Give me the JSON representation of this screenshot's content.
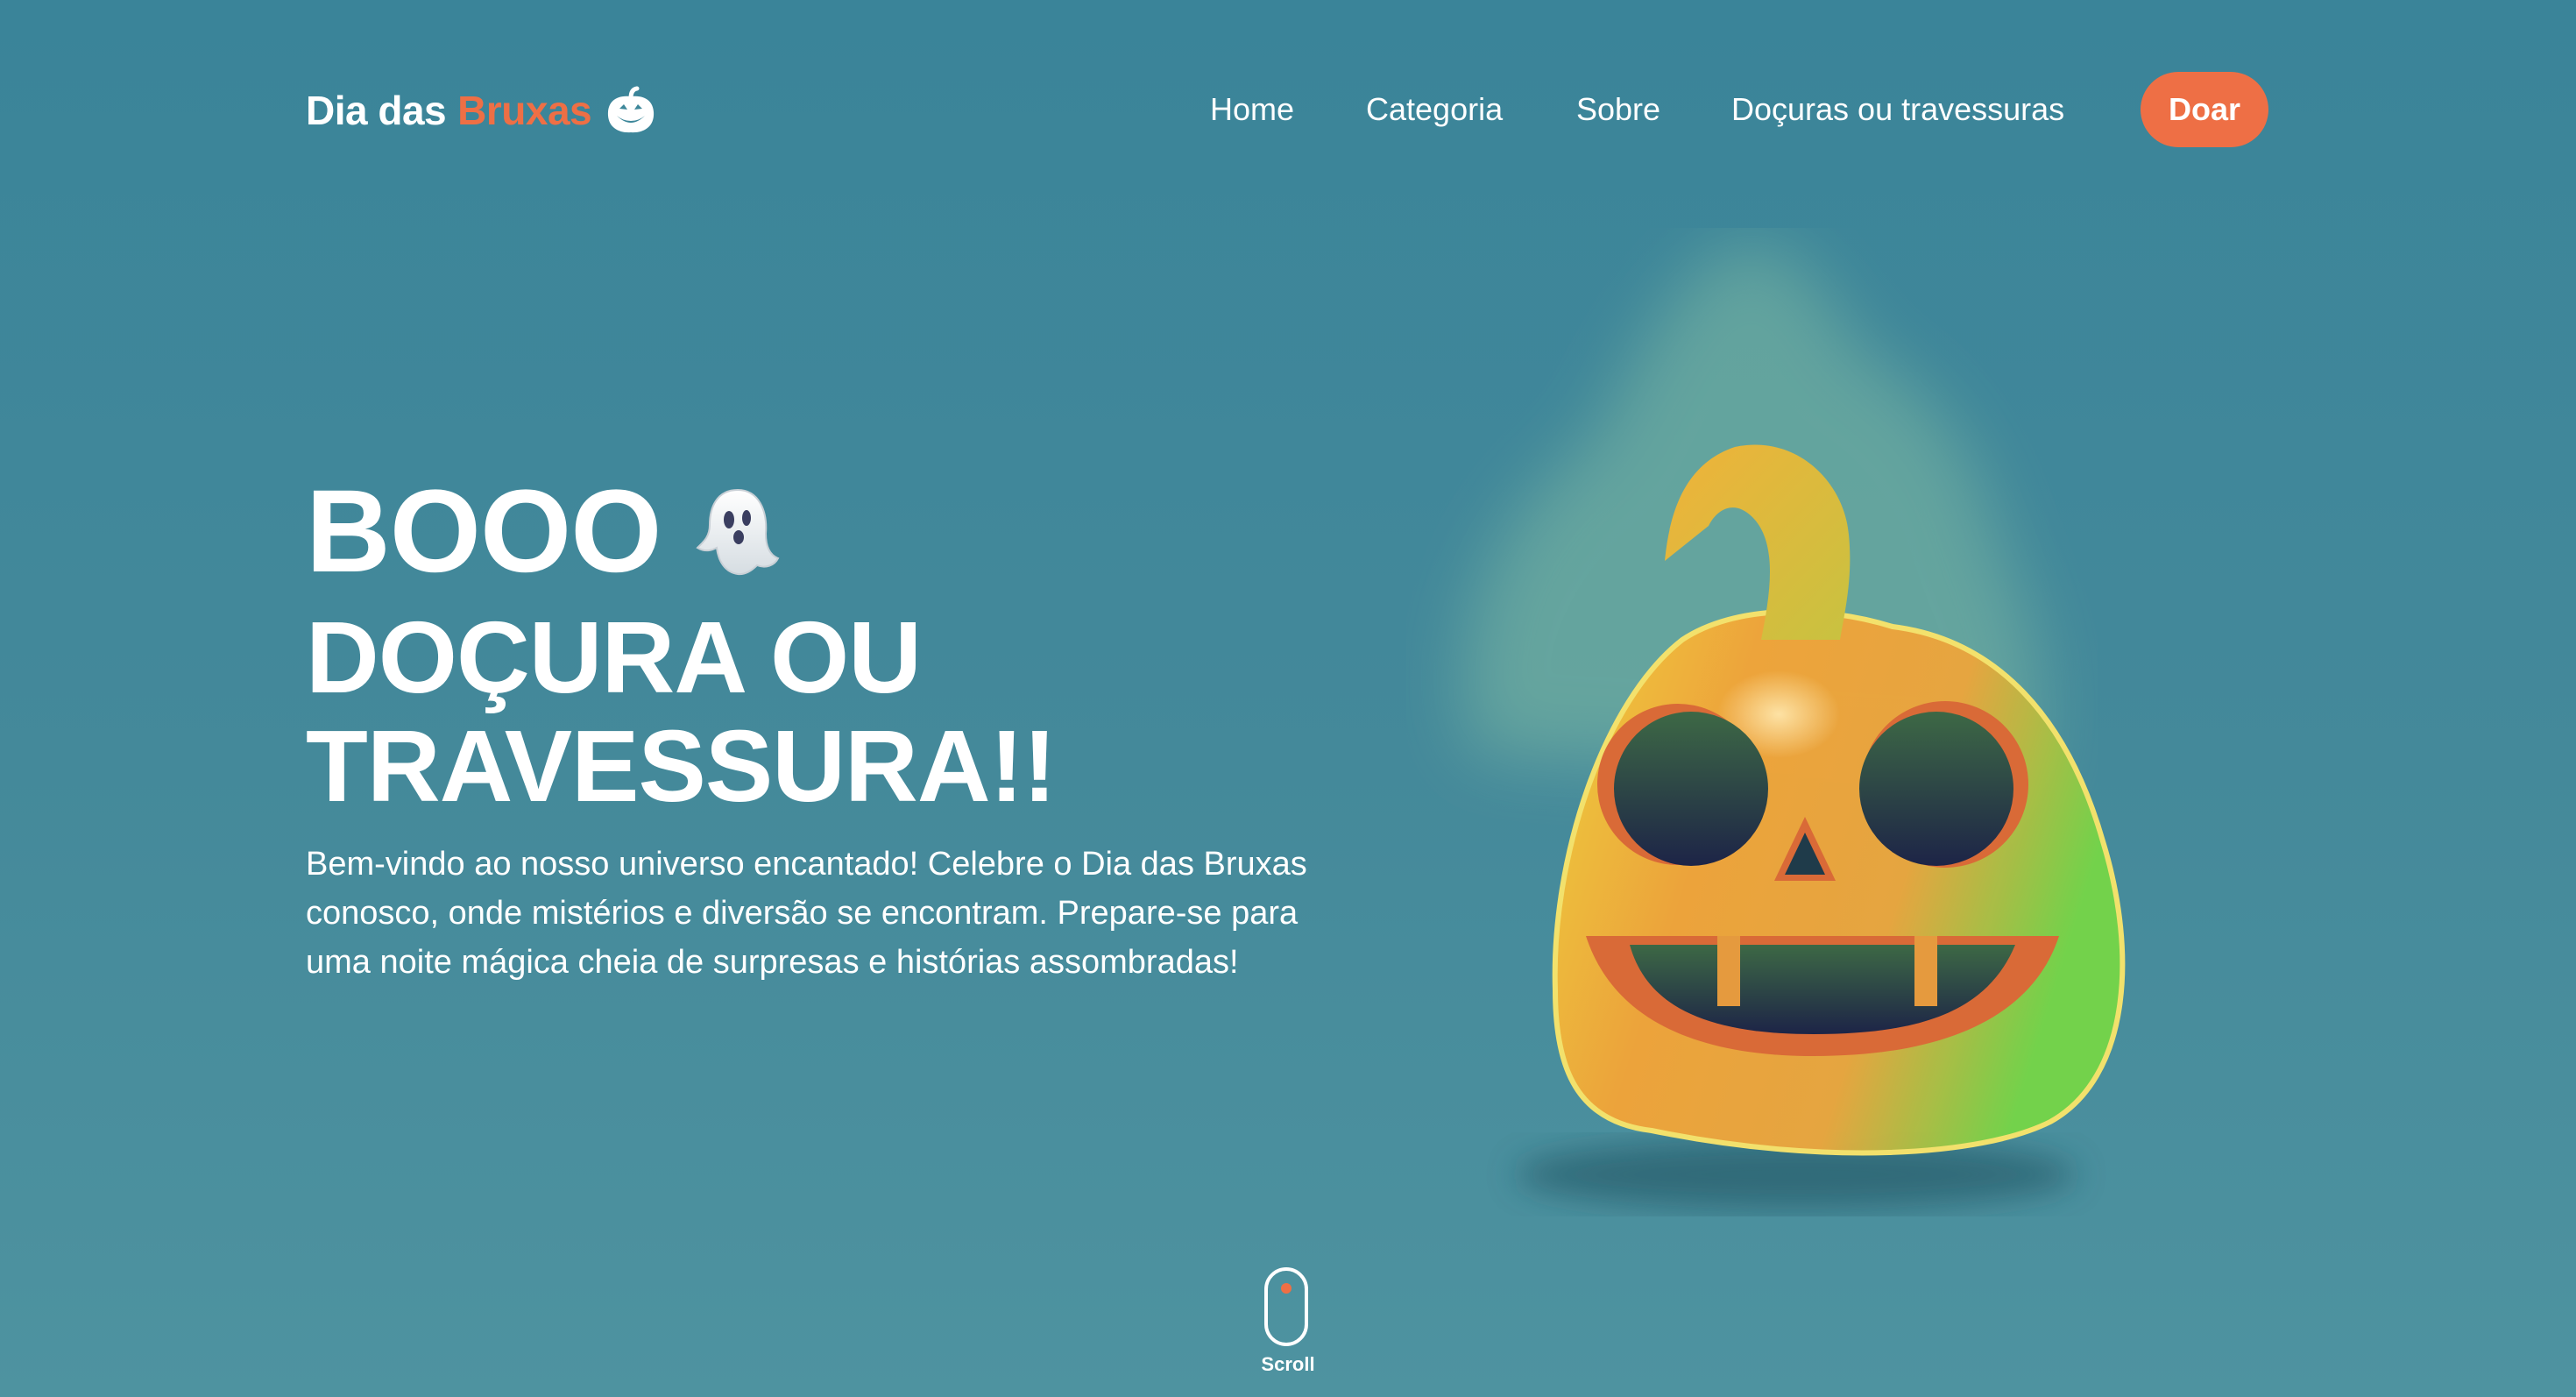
{
  "logo": {
    "part1": "Dia das",
    "part2": "Bruxas",
    "icon": "pumpkin-icon"
  },
  "nav": {
    "items": [
      "Home",
      "Categoria",
      "Sobre",
      "Doçuras ou travessuras"
    ],
    "cta": "Doar"
  },
  "hero": {
    "title": "BOOO",
    "title_icon": "ghost-icon",
    "subtitle_line1": "DOÇURA OU",
    "subtitle_line2": "TRAVESSURA!!",
    "description": "Bem-vindo ao nosso universo encantado! Celebre o Dia das Bruxas conosco, onde mistérios e diversão se encontram. Prepare-se para uma noite mágica cheia de surpresas e histórias assombradas!"
  },
  "scroll": {
    "label": "Scroll",
    "icon": "mouse-scroll-icon"
  },
  "colors": {
    "background": "#3d879a",
    "accent": "#ee6f45",
    "text": "#ffffff"
  }
}
